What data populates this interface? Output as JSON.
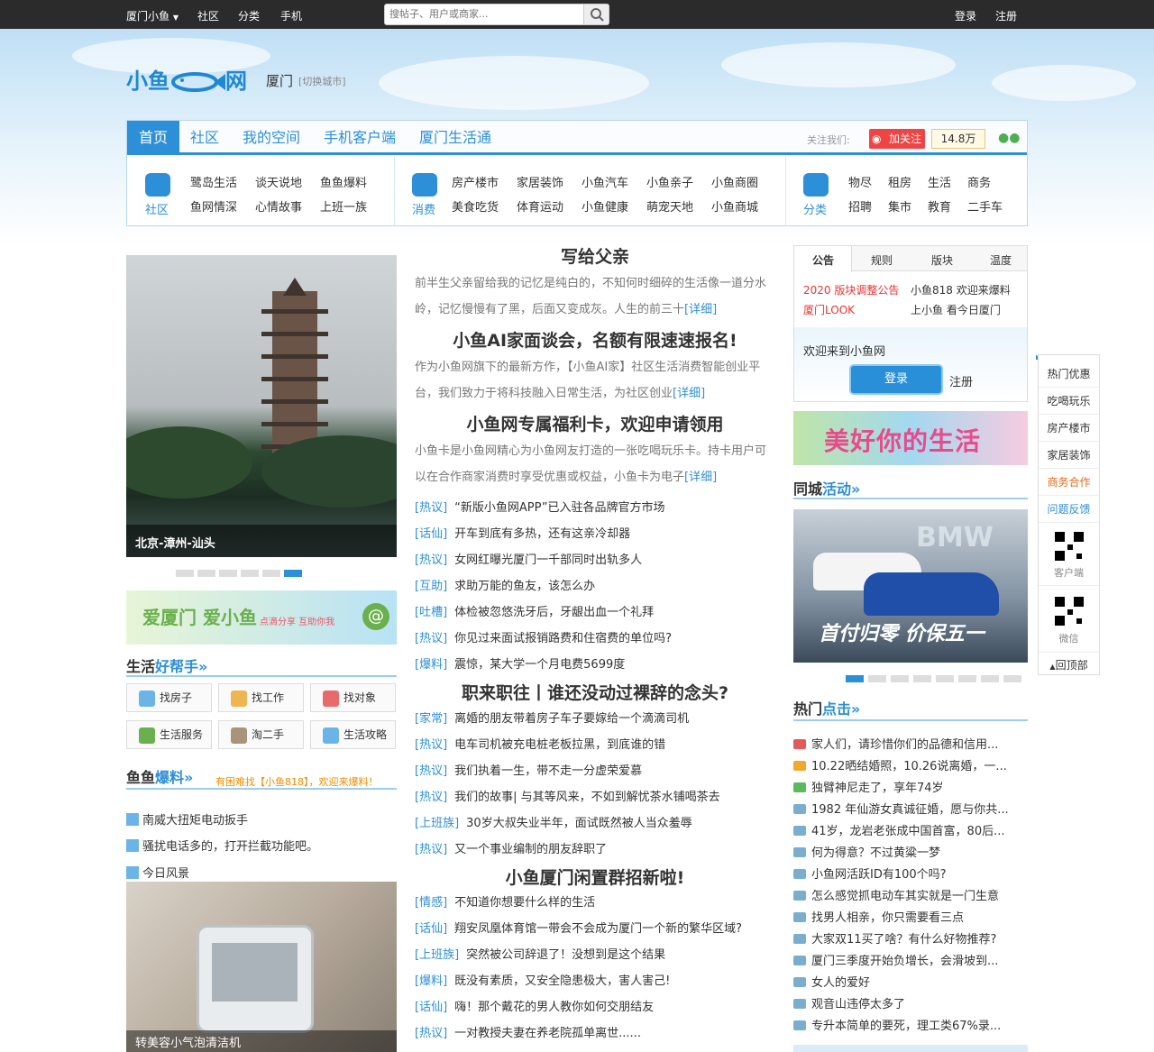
{
  "topbar": {
    "city_menu": "厦门小鱼",
    "community": "社区",
    "category": "分类",
    "mobile": "手机",
    "search_placeholder": "搜帖子、用户或商家...",
    "login": "登录",
    "register": "注册"
  },
  "header": {
    "logo": "小鱼",
    "logo_suffix": "网",
    "city": "厦门",
    "switch_city": "[切换城市]"
  },
  "nav": {
    "tabs": [
      "首页",
      "社区",
      "我的空间",
      "手机客户端",
      "厦门生活通"
    ],
    "follow_label": "关注我们:",
    "follow_button": "加关注",
    "fans": "14.8万"
  },
  "sections": [
    {
      "label": "社区",
      "links": [
        "鹭岛生活",
        "谈天说地",
        "鱼鱼爆料",
        "鱼网情深",
        "心情故事",
        "上班一族"
      ]
    },
    {
      "label": "消费",
      "links": [
        "房产楼市",
        "家居装饰",
        "小鱼汽车",
        "小鱼亲子",
        "小鱼商圈",
        "美食吃货",
        "体育运动",
        "小鱼健康",
        "萌宠天地",
        "小鱼商城"
      ]
    },
    {
      "label": "分类",
      "links": [
        "物尽",
        "租房",
        "生活",
        "商务",
        "招聘",
        "集市",
        "教育",
        "二手车"
      ]
    }
  ],
  "slider": {
    "caption": "北京-漳州-汕头"
  },
  "banner1": {
    "text1": "爱厦门 爱小鱼",
    "text2": "点滴分享 互助你我"
  },
  "help": {
    "title": "生活",
    "title_accent": "好帮手»",
    "items": [
      "找房子",
      "找工作",
      "找对象",
      "生活服务",
      "淘二手",
      "生活攻略"
    ]
  },
  "baoliao": {
    "title": "鱼鱼",
    "title_accent": "爆料»",
    "note": "有困难找【小鱼818】，欢迎来爆料！",
    "items": [
      "南威大扭矩电动扳手",
      "骚扰电话多的，打开拦截功能吧。",
      "今日风景"
    ],
    "photo_caption": "转美容小气泡清洁机"
  },
  "middle": {
    "headline1": "写给父亲",
    "summary1": "前半生父亲留给我的记忆是纯白的，不知何时细碎的生活像一道分水岭，记忆慢慢有了黑，后面又变成灰。人生的前三十",
    "headline2": "小鱼AI家面谈会，名额有限速速报名!",
    "summary2": "作为小鱼网旗下的最新方作，【小鱼AI家】社区生活消费智能创业平台，我们致力于将科技融入日常生活，为社区创业",
    "headline3": "小鱼网专属福利卡，欢迎申请领用",
    "summary3": "小鱼卡是小鱼网精心为小鱼网友打造的一张吃喝玩乐卡。持卡用户可以在合作商家消费时享受优惠或权益，小鱼卡为电子",
    "detail": "[详细]",
    "list1": [
      [
        "[热议]",
        "“新版小鱼网APP”已入驻各品牌官方市场"
      ],
      [
        "[话仙]",
        "开车到底有多热，还有这亲冷却器"
      ],
      [
        "[热议]",
        "女网红曝光厦门一千部同时出轨多人"
      ],
      [
        "[互助]",
        "求助万能的鱼友，该怎么办"
      ],
      [
        "[吐槽]",
        "体检被忽悠洗牙后，牙龈出血一个礼拜"
      ],
      [
        "[热议]",
        "你见过来面试报销路费和住宿费的单位吗?"
      ],
      [
        "[爆料]",
        "震惊，某大学一个月电费5699度"
      ]
    ],
    "headline4": "职来职往丨谁还没动过裸辞的念头?",
    "list2": [
      [
        "[家常]",
        "离婚的朋友带着房子车子要嫁给一个滴滴司机"
      ],
      [
        "[热议]",
        "电车司机被充电桩老板拉黑，到底谁的错"
      ],
      [
        "[热议]",
        "我们执着一生，带不走一分虚荣爱慕"
      ],
      [
        "[热议]",
        "我们的故事| 与其等风来，不如到解忧茶水铺喝茶去"
      ],
      [
        "[上班族]",
        "30岁大叔失业半年，面试既然被人当众羞辱"
      ],
      [
        "[热议]",
        "又一个事业编制的朋友辞职了"
      ]
    ],
    "headline5": "小鱼厦门闲置群招新啦!",
    "list3": [
      [
        "[情感]",
        "不知道你想要什么样的生活"
      ],
      [
        "[话仙]",
        "翔安凤凰体育馆一带会不会成为厦门一个新的繁华区域?"
      ],
      [
        "[上班族]",
        "突然被公司辞退了！没想到是这个结果"
      ],
      [
        "[爆料]",
        "既没有素质，又安全隐患极大，害人害己!"
      ],
      [
        "[话仙]",
        "嗨！那个戴花的男人教你如何交朋结友"
      ],
      [
        "[热议]",
        "一对教授夫妻在养老院孤单离世......"
      ]
    ]
  },
  "notice": {
    "tabs": [
      "公告",
      "规则",
      "版块",
      "温度"
    ],
    "items": [
      "2020 版块调整公告",
      "小鱼818 欢迎来爆料",
      "厦门LOOK",
      "上小鱼 看今日厦门"
    ],
    "welcome": "欢迎来到小鱼网",
    "login": "登录",
    "register": "注册"
  },
  "banner2": {
    "text": "美好你的生活"
  },
  "activity": {
    "title": "同城",
    "title_accent": "活动»",
    "ad_text": "首付归零 价保五一",
    "brand": "BMW"
  },
  "hot": {
    "title": "热门",
    "title_accent": "点击»",
    "items": [
      "家人们，请珍惜你们的品德和信用...",
      "10.22晒结婚照，10.26说离婚，一...",
      "独臂神尼走了，享年74岁",
      "1982 年仙游女真诚征婚，愿与你共...",
      "41岁，龙岩老张成中国首富，80后...",
      "何为得意？不过黄粱一梦",
      "小鱼网活跃ID有100个吗?",
      "怎么感觉抓电动车其实就是一门生意",
      "找男人相亲，你只需要看三点",
      "大家双11买了啥？有什么好物推荐?",
      "厦门三季度开始负增长，会滑坡到...",
      "女人的爱好",
      "观音山违停太多了",
      "专升本简单的要死，理工类67%录..."
    ],
    "colors": [
      "#e35a5a",
      "#f0a830",
      "#5cb85c",
      "#7aaecf"
    ]
  },
  "sidebar": {
    "items": [
      "热门优惠",
      "吃喝玩乐",
      "房产楼市",
      "家居装饰",
      "商务合作",
      "问题反馈"
    ],
    "client": "客户端",
    "wechat": "微信",
    "top": "回顶部"
  }
}
